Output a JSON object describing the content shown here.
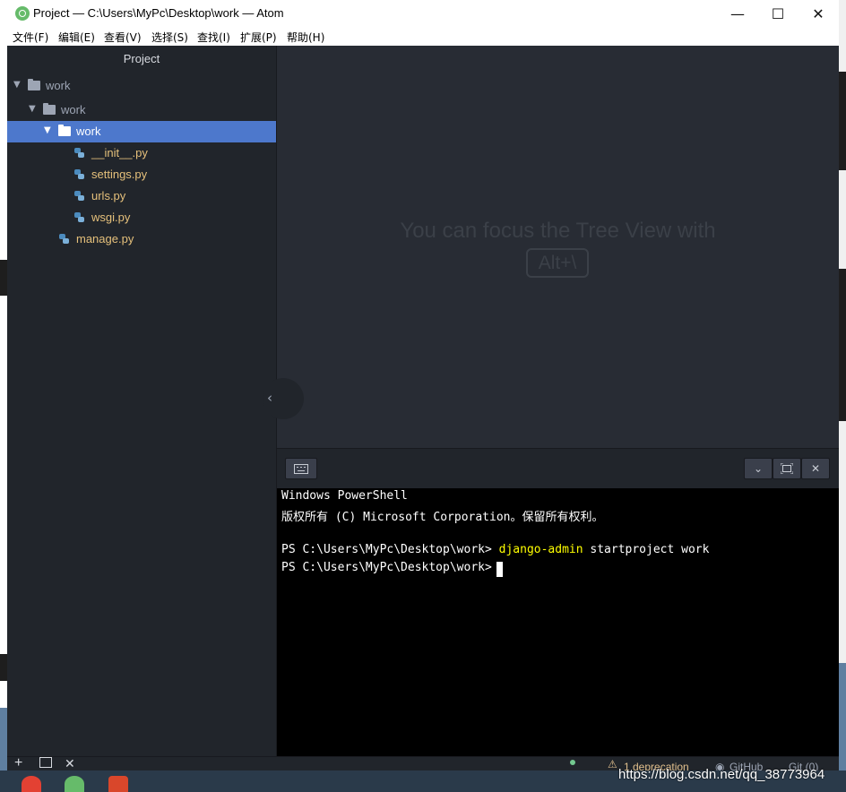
{
  "window": {
    "title": "Project — C:\\Users\\MyPc\\Desktop\\work — Atom",
    "controls": {
      "minimize": "—",
      "maximize": "☐",
      "close": "✕"
    }
  },
  "menu": [
    "文件(F)",
    "编辑(E)",
    "查看(V)",
    "选择(S)",
    "查找(I)",
    "扩展(P)",
    "帮助(H)"
  ],
  "tree": {
    "header": "Project",
    "items": [
      {
        "label": "work",
        "kind": "folder",
        "depth": 0
      },
      {
        "label": "work",
        "kind": "folder",
        "depth": 1
      },
      {
        "label": "work",
        "kind": "folder",
        "depth": 2,
        "selected": true
      },
      {
        "label": "__init__.py",
        "kind": "file",
        "depth": 3
      },
      {
        "label": "settings.py",
        "kind": "file",
        "depth": 3
      },
      {
        "label": "urls.py",
        "kind": "file",
        "depth": 3
      },
      {
        "label": "wsgi.py",
        "kind": "file",
        "depth": 3
      },
      {
        "label": "manage.py",
        "kind": "file",
        "depth": 2
      }
    ]
  },
  "editor": {
    "hint": "You can focus the Tree View with",
    "shortcut": "Alt+\\"
  },
  "terminal": {
    "lines": [
      {
        "text": "Windows PowerShell"
      },
      {
        "text": "版权所有 (C) Microsoft Corporation。保留所有权利。"
      },
      {
        "text": ""
      },
      {
        "prompt": "PS C:\\Users\\MyPc\\Desktop\\work> ",
        "command": "django-admin",
        "args": " startproject work"
      },
      {
        "prompt": "PS C:\\Users\\MyPc\\Desktop\\work> "
      }
    ]
  },
  "status": {
    "deprecation": "1 deprecation",
    "github": "GitHub",
    "git": "Git (0)"
  },
  "watermark": "https://blog.csdn.net/qq_38773964",
  "colors": {
    "tree_bg": "#21252b",
    "editor_bg": "#282c34",
    "selection": "#4d78cc",
    "file_label": "#e5c07b",
    "terminal_cmd": "#ffff00"
  }
}
